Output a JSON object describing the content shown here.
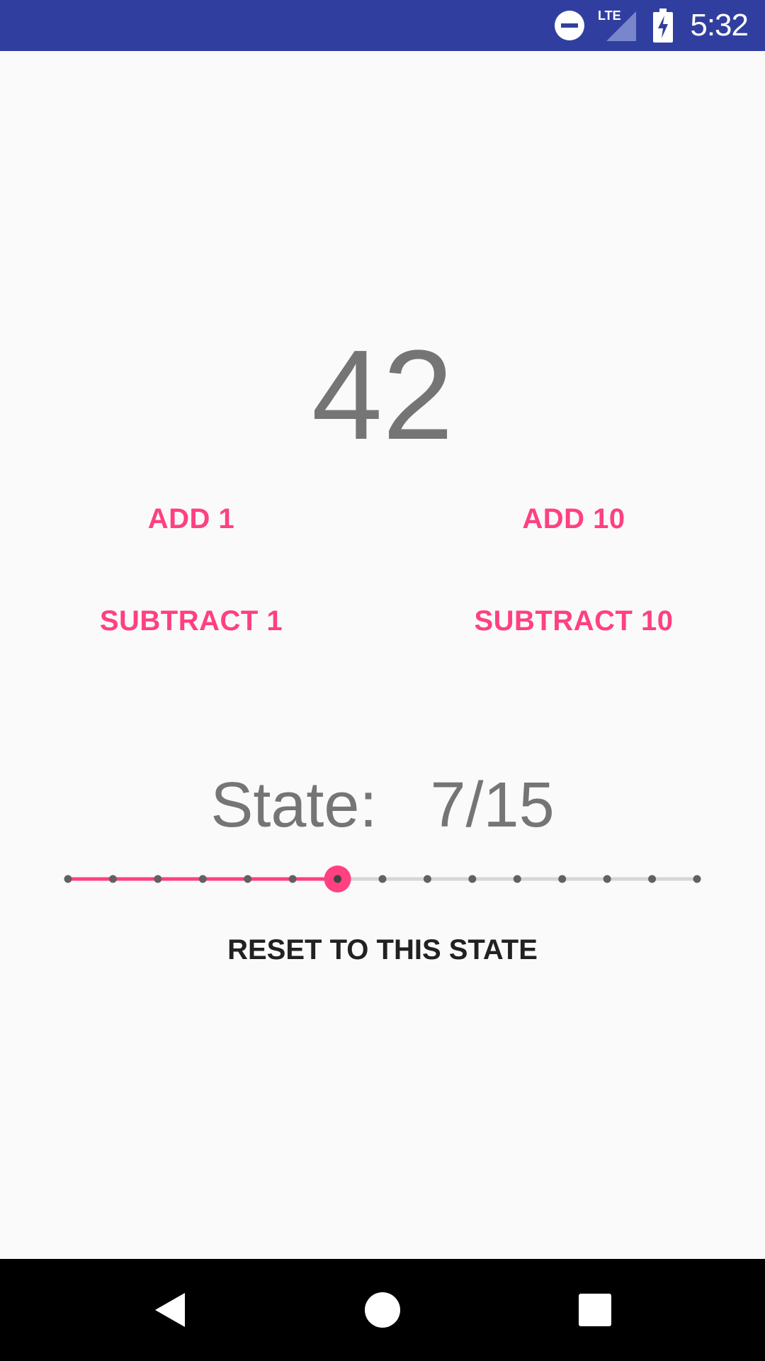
{
  "status_bar": {
    "time": "5:32",
    "network": "LTE",
    "icons": [
      "do-not-disturb-icon",
      "signal-icon",
      "battery-charging-icon"
    ],
    "color": "#303f9f"
  },
  "counter": {
    "value": "42"
  },
  "buttons": {
    "add_1": "ADD 1",
    "add_10": "ADD 10",
    "subtract_1": "SUBTRACT 1",
    "subtract_10": "SUBTRACT 10",
    "reset": "RESET TO THIS STATE"
  },
  "state": {
    "label": "State:   7/15",
    "current": 7,
    "total": 15
  },
  "navigation": {
    "icons": [
      "back-icon",
      "home-icon",
      "recents-icon"
    ]
  },
  "colors": {
    "accent": "#ff4081",
    "text_gray": "#757575",
    "primary_dark": "#303f9f"
  }
}
